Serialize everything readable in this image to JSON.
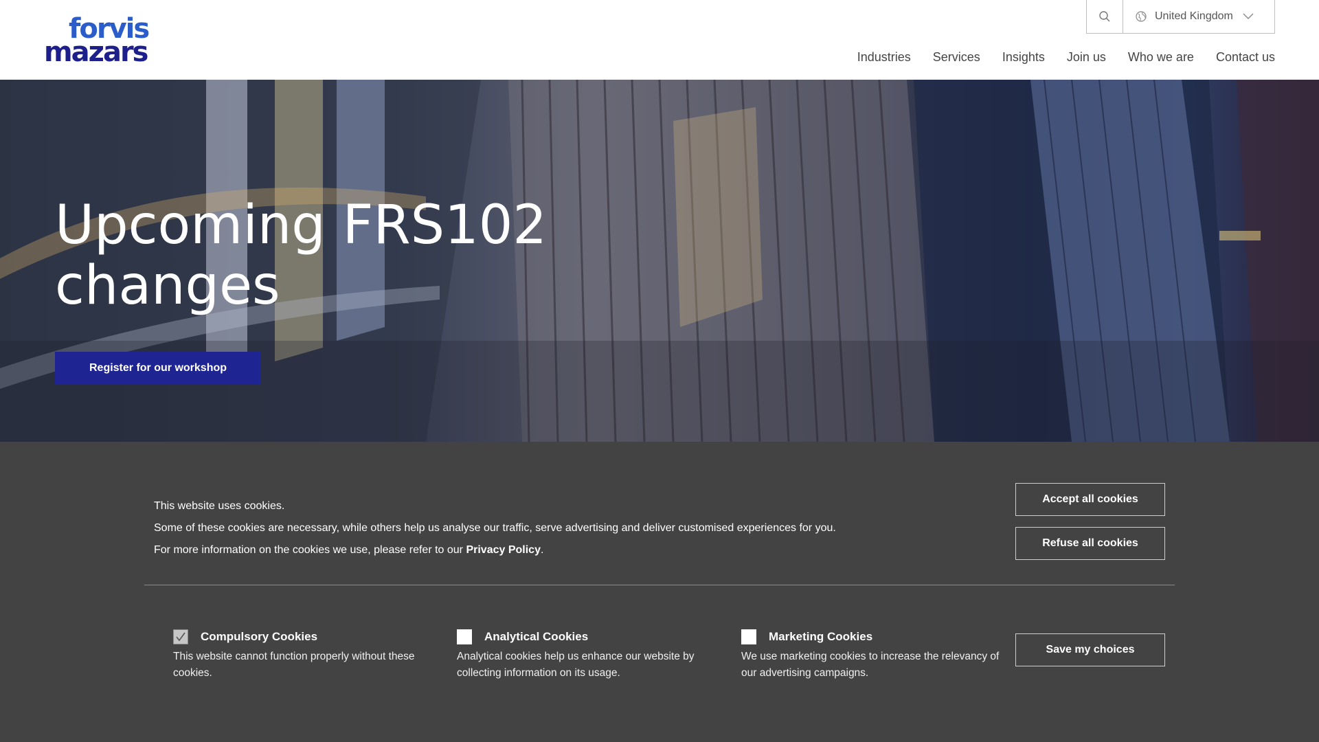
{
  "brand": {
    "logo_line1": "forvis",
    "logo_line2": "mazars",
    "primary_color": "#1e2491",
    "logo_light_color": "#2a5dc9"
  },
  "utility": {
    "search_icon": "search-icon",
    "country": "United Kingdom"
  },
  "nav": {
    "items": [
      "Industries",
      "Services",
      "Insights",
      "Join us",
      "Who we are",
      "Contact us"
    ]
  },
  "hero": {
    "title_line1": "Upcoming FRS102",
    "title_line2": "changes",
    "cta": "Register for our workshop"
  },
  "cookies": {
    "line1": "This website uses cookies.",
    "line2": "Some of these cookies are necessary, while others help us analyse our traffic, serve advertising and deliver customised experiences for you.",
    "line3_prefix": "For more information on the cookies we use, please refer to our ",
    "privacy_link": "Privacy Policy",
    "line3_suffix": ".",
    "accept_all": "Accept all cookies",
    "refuse_all": "Refuse all cookies",
    "save": "Save my choices",
    "options": [
      {
        "title": "Compulsory Cookies",
        "description": "This website cannot function properly without these cookies.",
        "checked": true,
        "disabled": true
      },
      {
        "title": "Analytical Cookies",
        "description": "Analytical cookies help us enhance our website by collecting information on its usage.",
        "checked": false,
        "disabled": false
      },
      {
        "title": "Marketing Cookies",
        "description": "We use marketing cookies to increase the relevancy of our advertising campaigns.",
        "checked": false,
        "disabled": false
      }
    ],
    "panel_color": "#434343"
  }
}
